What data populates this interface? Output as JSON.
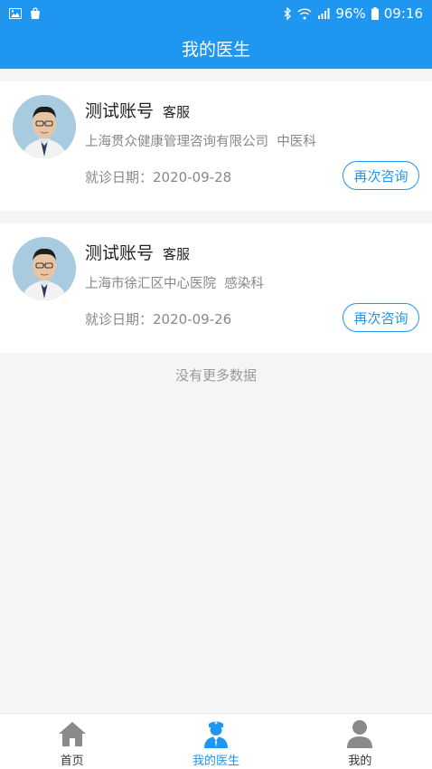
{
  "status_bar": {
    "battery": "96%",
    "time": "09:16"
  },
  "header": {
    "title": "我的医生"
  },
  "doctors": [
    {
      "name": "测试账号",
      "role": "客服",
      "hospital": "上海贯众健康管理咨询有限公司",
      "department": "中医科",
      "visit_date": "就诊日期：2020-09-28",
      "action_label": "再次咨询"
    },
    {
      "name": "测试账号",
      "role": "客服",
      "hospital": "上海市徐汇区中心医院",
      "department": "感染科",
      "visit_date": "就诊日期：2020-09-26",
      "action_label": "再次咨询"
    }
  ],
  "list_footer": "没有更多数据",
  "tabbar": {
    "items": [
      {
        "label": "首页",
        "icon": "home-icon"
      },
      {
        "label": "我的医生",
        "icon": "doctor-icon"
      },
      {
        "label": "我的",
        "icon": "user-icon"
      }
    ],
    "active_index": 1
  },
  "colors": {
    "accent": "#1f96f0",
    "inactive_icon": "#8a8a8a"
  }
}
